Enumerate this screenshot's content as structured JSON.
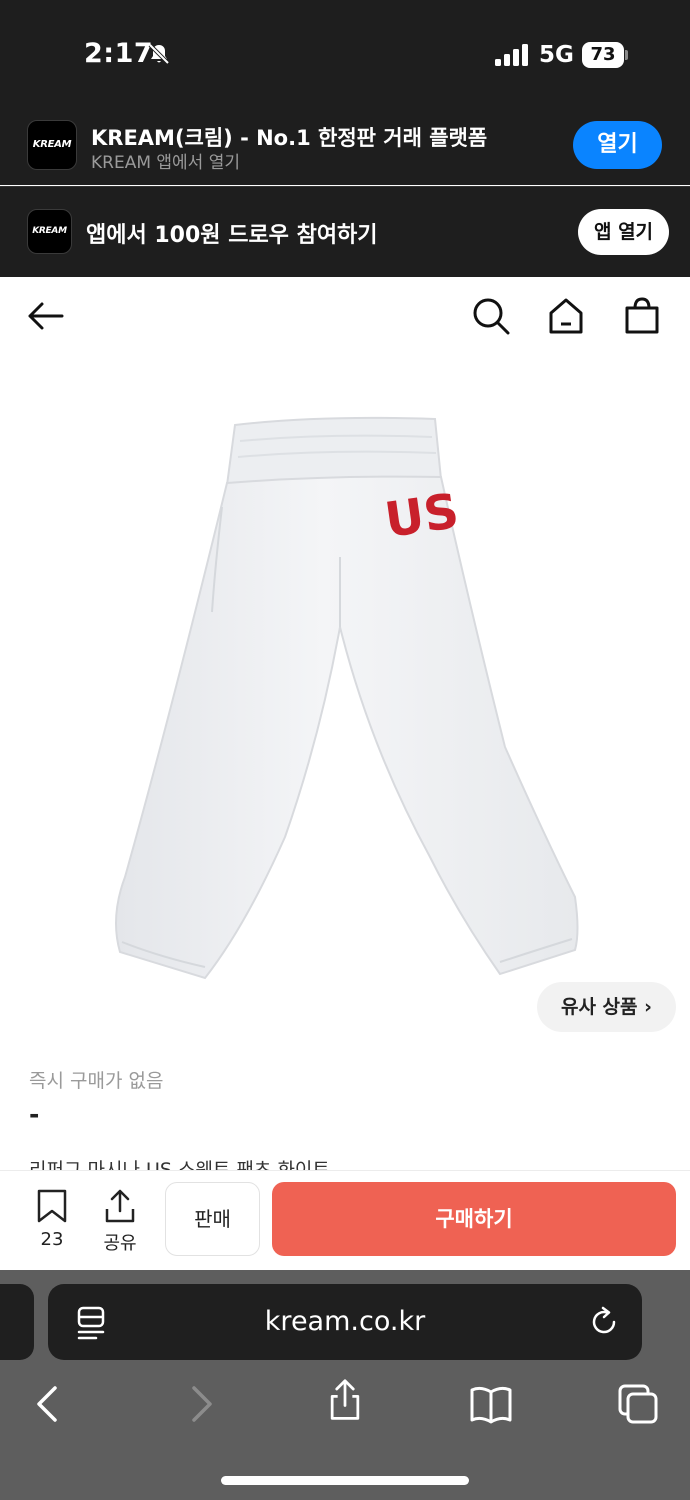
{
  "status_bar": {
    "time": "2:17",
    "network": "5G",
    "battery": "73",
    "icons": [
      "bell-slash-icon",
      "signal-icon",
      "battery-icon"
    ]
  },
  "smart_banner": {
    "logo_text": "KREAM",
    "title": "KREAM(크림) - No.1 한정판 거래 플랫폼",
    "subtitle": "KREAM 앱에서 열기",
    "open_label": "열기",
    "open_color": "#0a84ff"
  },
  "promo_banner": {
    "logo_text": "KREAM",
    "text": "앱에서 100원 드로우 참여하기",
    "button_label": "앱 열기"
  },
  "header": {
    "icons": [
      "back-arrow-icon",
      "search-icon",
      "home-icon",
      "shopping-bag-icon"
    ]
  },
  "product": {
    "patch_text": "US",
    "patch_color": "#c8202b",
    "similar_label": "유사 상품",
    "instant_label": "즉시 구매가 없음",
    "price": "-",
    "name": "리퍼그 마시나 US 스웨트 팬츠 화이트"
  },
  "actions": {
    "bookmark_count": "23",
    "share_label": "공유",
    "sell_label": "판매",
    "buy_label": "구매하기",
    "buy_color": "#ef6253"
  },
  "browser": {
    "url": "kream.co.kr",
    "toolbar_icons": [
      "back-icon",
      "forward-icon",
      "share-icon",
      "bookmarks-icon",
      "tabs-icon"
    ]
  }
}
